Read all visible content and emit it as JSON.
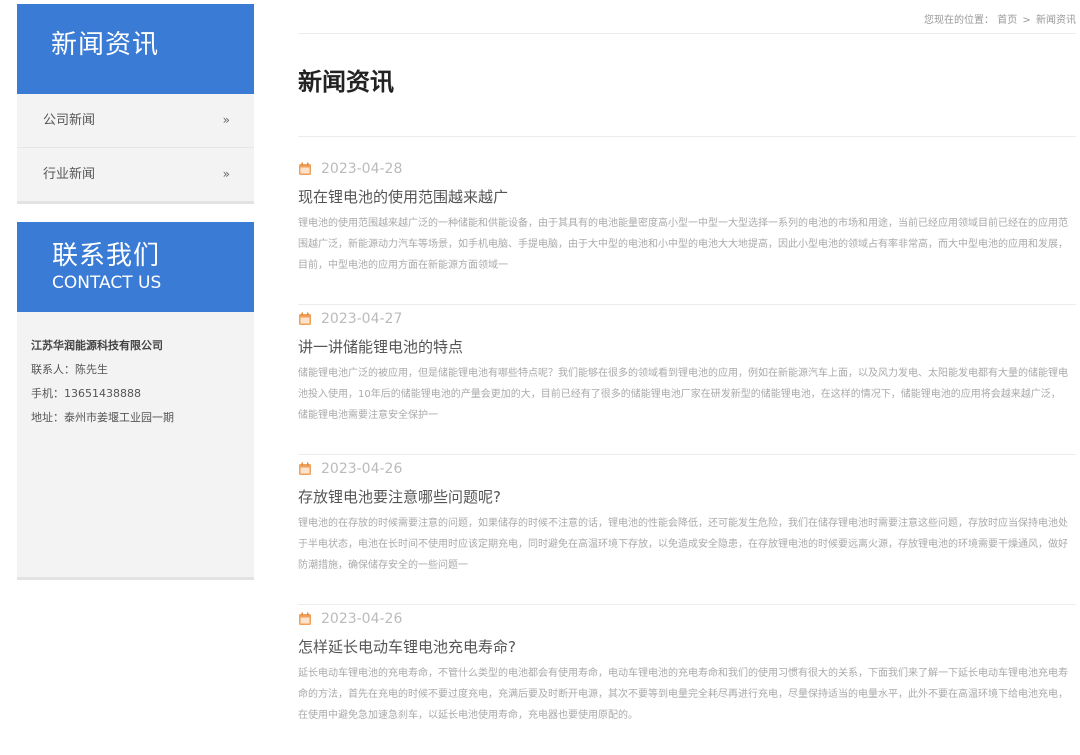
{
  "sidebar": {
    "news_title": "新闻资讯",
    "menu": [
      {
        "label": "公司新闻",
        "arrow": "»"
      },
      {
        "label": "行业新闻",
        "arrow": "»"
      }
    ],
    "contact_title_cn": "联系我们",
    "contact_title_en": "CONTACT US",
    "contact": {
      "company": "江苏华润能源科技有限公司",
      "person": "联系人：陈先生",
      "phone": "手机：13651438888",
      "address": "地址：泰州市姜堰工业园一期"
    }
  },
  "breadcrumb": {
    "prefix": "您现在的位置：",
    "home": "首页",
    "separator": ">",
    "current": "新闻资讯"
  },
  "page_title": "新闻资讯",
  "news": [
    {
      "date": "2023-04-28",
      "title": "现在锂电池的使用范围越来越广",
      "summary": "锂电池的使用范围越来越广泛的一种储能和供能设备，由于其具有的电池能量密度高小型一中型一大型选择一系列的电池的市场和用途，当前已经应用领域目前已经在的应用范围越广泛，新能源动力汽车等场景，如手机电脑、手提电脑，由于大中型的电池和小中型的电池大大地提高，因此小型电池的领域占有率非常高，而大中型电池的应用和发展，目前，中型电池的应用方面在新能源方面领域一"
    },
    {
      "date": "2023-04-27",
      "title": "讲一讲储能锂电池的特点",
      "summary": "储能锂电池广泛的被应用，但是储能锂电池有哪些特点呢？我们能够在很多的领域看到锂电池的应用，例如在新能源汽车上面，以及风力发电、太阳能发电都有大量的储能锂电池投入使用，10年后的储能锂电池的产量会更加的大，目前已经有了很多的储能锂电池厂家在研发新型的储能锂电池，在这样的情况下，储能锂电池的应用将会越来越广泛，储能锂电池需要注意安全保护一"
    },
    {
      "date": "2023-04-26",
      "title": "存放锂电池要注意哪些问题呢?",
      "summary": "锂电池的在存放的时候需要注意的问题，如果储存的时候不注意的话，锂电池的性能会降低，还可能发生危险，我们在储存锂电池时需要注意这些问题，存放时应当保持电池处于半电状态，电池在长时间不使用时应该定期充电，同时避免在高温环境下存放，以免造成安全隐患，在存放锂电池的时候要远离火源，存放锂电池的环境需要干燥通风，做好防潮措施，确保储存安全的一些问题一"
    },
    {
      "date": "2023-04-26",
      "title": "怎样延长电动车锂电池充电寿命?",
      "summary": "延长电动车锂电池的充电寿命，不管什么类型的电池都会有使用寿命，电动车锂电池的充电寿命和我们的使用习惯有很大的关系，下面我们来了解一下延长电动车锂电池充电寿命的方法，首先在充电的时候不要过度充电，充满后要及时断开电源，其次不要等到电量完全耗尽再进行充电，尽量保持适当的电量水平，此外不要在高温环境下给电池充电，在使用中避免急加速急刹车，以延长电池使用寿命，充电器也要使用原配的。"
    }
  ],
  "colors": {
    "accent": "#3a7bd5",
    "date_icon": "#f0a05a"
  }
}
